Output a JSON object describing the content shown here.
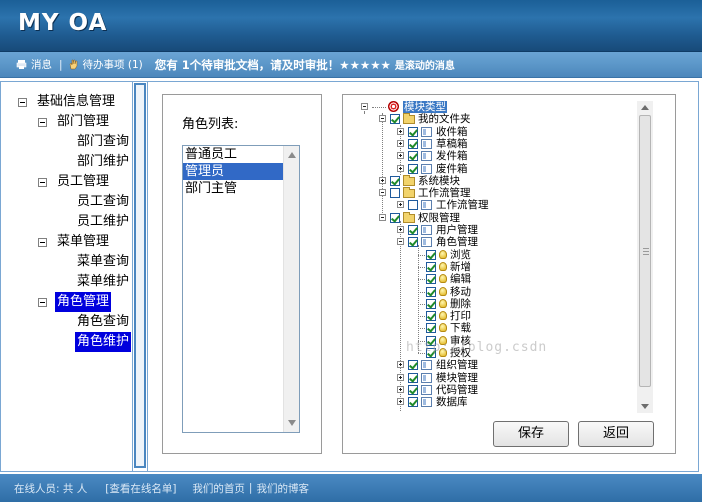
{
  "app": {
    "title": "MY OA"
  },
  "subbar": {
    "messages_label": "消息",
    "todo_label": "待办事项 (1)",
    "notice_main": "您有 1个待审批文档，请及时审批！★★★★★",
    "notice_tail": "是滚动的消息"
  },
  "left_tree": {
    "root": "基础信息管理",
    "groups": [
      {
        "label": "部门管理",
        "children": [
          "部门查询",
          "部门维护"
        ]
      },
      {
        "label": "员工管理",
        "children": [
          "员工查询",
          "员工维护"
        ]
      },
      {
        "label": "菜单管理",
        "children": [
          "菜单查询",
          "菜单维护"
        ]
      },
      {
        "label": "角色管理",
        "children": [
          "角色查询",
          "角色维护"
        ]
      }
    ],
    "selected": [
      "角色管理",
      "角色维护"
    ]
  },
  "role_panel": {
    "title": "角色列表:",
    "options": [
      "普通员工",
      "管理员",
      "部门主管"
    ],
    "selected": "管理员"
  },
  "module_tree": {
    "nodes": [
      {
        "label": "模块类型",
        "level": 0,
        "icon": "target-icon",
        "toggle": "minus",
        "checked": null,
        "selected": true
      },
      {
        "label": "我的文件夹",
        "level": 1,
        "icon": "folder-icon",
        "toggle": "minus",
        "checked": true
      },
      {
        "label": "收件箱",
        "level": 2,
        "icon": "page-icon",
        "toggle": "plus",
        "checked": true
      },
      {
        "label": "草稿箱",
        "level": 2,
        "icon": "page-icon",
        "toggle": "plus",
        "checked": true
      },
      {
        "label": "发件箱",
        "level": 2,
        "icon": "page-icon",
        "toggle": "plus",
        "checked": true
      },
      {
        "label": "废件箱",
        "level": 2,
        "icon": "page-icon",
        "toggle": "plus",
        "checked": true
      },
      {
        "label": "系统模块",
        "level": 1,
        "icon": "folder-icon",
        "toggle": "plus",
        "checked": true
      },
      {
        "label": "工作流管理",
        "level": 1,
        "icon": "folder-icon",
        "toggle": "minus",
        "checked": false
      },
      {
        "label": "工作流管理",
        "level": 2,
        "icon": "page-icon",
        "toggle": "plus",
        "checked": false
      },
      {
        "label": "权限管理",
        "level": 1,
        "icon": "folder-icon",
        "toggle": "minus",
        "checked": true
      },
      {
        "label": "用户管理",
        "level": 2,
        "icon": "page-icon",
        "toggle": "plus",
        "checked": true
      },
      {
        "label": "角色管理",
        "level": 2,
        "icon": "page-icon",
        "toggle": "minus",
        "checked": true
      },
      {
        "label": "浏览",
        "level": 3,
        "icon": "bulb-icon",
        "toggle": null,
        "checked": true
      },
      {
        "label": "新增",
        "level": 3,
        "icon": "bulb-icon",
        "toggle": null,
        "checked": true
      },
      {
        "label": "编辑",
        "level": 3,
        "icon": "bulb-icon",
        "toggle": null,
        "checked": true
      },
      {
        "label": "移动",
        "level": 3,
        "icon": "bulb-icon",
        "toggle": null,
        "checked": true
      },
      {
        "label": "删除",
        "level": 3,
        "icon": "bulb-icon",
        "toggle": null,
        "checked": true
      },
      {
        "label": "打印",
        "level": 3,
        "icon": "bulb-icon",
        "toggle": null,
        "checked": true
      },
      {
        "label": "下载",
        "level": 3,
        "icon": "bulb-icon",
        "toggle": null,
        "checked": true
      },
      {
        "label": "审核",
        "level": 3,
        "icon": "bulb-icon",
        "toggle": null,
        "checked": true
      },
      {
        "label": "授权",
        "level": 3,
        "icon": "bulb-icon",
        "toggle": null,
        "checked": true
      },
      {
        "label": "组织管理",
        "level": 2,
        "icon": "page-icon",
        "toggle": "plus",
        "checked": true
      },
      {
        "label": "模块管理",
        "level": 2,
        "icon": "page-icon",
        "toggle": "plus",
        "checked": true
      },
      {
        "label": "代码管理",
        "level": 2,
        "icon": "page-icon",
        "toggle": "plus",
        "checked": true
      },
      {
        "label": "数据库",
        "level": 2,
        "icon": "page-icon",
        "toggle": "plus",
        "checked": true
      }
    ]
  },
  "buttons": {
    "save": "保存",
    "back": "返回"
  },
  "footer": {
    "online_users": "在线人员: 共 人",
    "view_online": "[查看在线名单]",
    "home": "我们的首页",
    "divider": "|",
    "blog": "我们的博客"
  },
  "watermark": "http://blog.csdn",
  "colors": {
    "header_dark": "#1b5f97",
    "subbar_blue": "#5d98ca",
    "selection_blue": "#0000dd",
    "list_selection": "#3169c6"
  }
}
